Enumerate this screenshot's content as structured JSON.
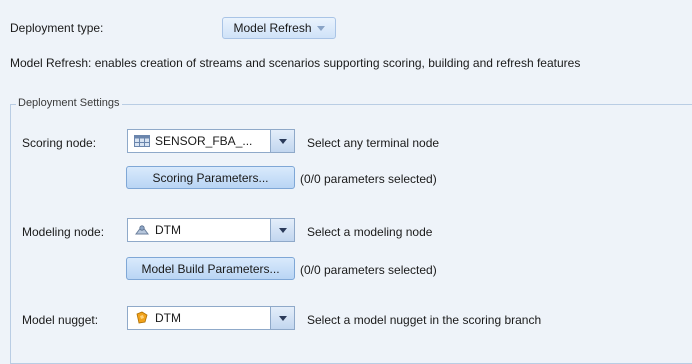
{
  "deployment_type": {
    "label": "Deployment type:",
    "value": "Model Refresh"
  },
  "description": "Model Refresh: enables creation of streams and scenarios supporting scoring, building and refresh features",
  "settings": {
    "legend": "Deployment Settings",
    "scoring_node": {
      "label": "Scoring node:",
      "value": "SENSOR_FBA_...",
      "icon": "table-node-icon",
      "hint": "Select any terminal node",
      "params_button": "Scoring Parameters...",
      "params_status": "(0/0 parameters selected)"
    },
    "modeling_node": {
      "label": "Modeling node:",
      "value": "DTM",
      "icon": "modeling-node-icon",
      "hint": "Select a modeling node",
      "params_button": "Model Build Parameters...",
      "params_status": "(0/0 parameters selected)"
    },
    "model_nugget": {
      "label": "Model nugget:",
      "value": "DTM",
      "icon": "model-nugget-icon",
      "hint": "Select a model nugget in the scoring branch"
    }
  },
  "colors": {
    "background": "#eef3f9",
    "button_border": "#7fa7d6",
    "nugget_icon": "#f0a21c"
  }
}
